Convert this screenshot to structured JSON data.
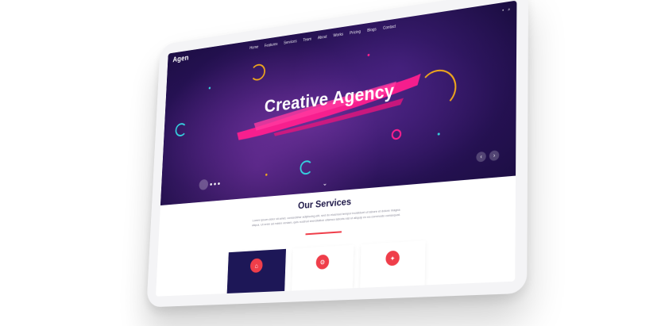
{
  "brand": {
    "logo": "Agen"
  },
  "nav": {
    "items": [
      "Home",
      "Features",
      "Services",
      "Team",
      "About",
      "Works",
      "Pricing",
      "Blogs",
      "Contact"
    ]
  },
  "hero": {
    "title": "Creative Agency",
    "accent_color": "#ff1f8e",
    "arrow_prev": "‹",
    "arrow_next": "›",
    "scroll_icon": "chevron-down-double-icon"
  },
  "services": {
    "title": "Our Services",
    "description": "Lorem ipsum dolor sit amet, consectetur adipiscing elit, sed do eiusmod tempor incididunt ut labore et dolore magna aliqua. Ut enim ad minim veniam, quis nostrud exercitation ullamco laboris nisi ut aliquip ex ea commodo consequat.",
    "underline_color": "#ef3e4a",
    "cards": [
      {
        "icon": "house-icon",
        "glyph": "⌂",
        "active": true
      },
      {
        "icon": "gear-icon",
        "glyph": "⚙",
        "active": false
      },
      {
        "icon": "idea-icon",
        "glyph": "✦",
        "active": false
      }
    ]
  },
  "colors": {
    "hero_dark": "#251152",
    "navy": "#1d1757",
    "pink": "#ff1f8e",
    "orange": "#f2a91b",
    "cyan": "#35d3e0"
  }
}
